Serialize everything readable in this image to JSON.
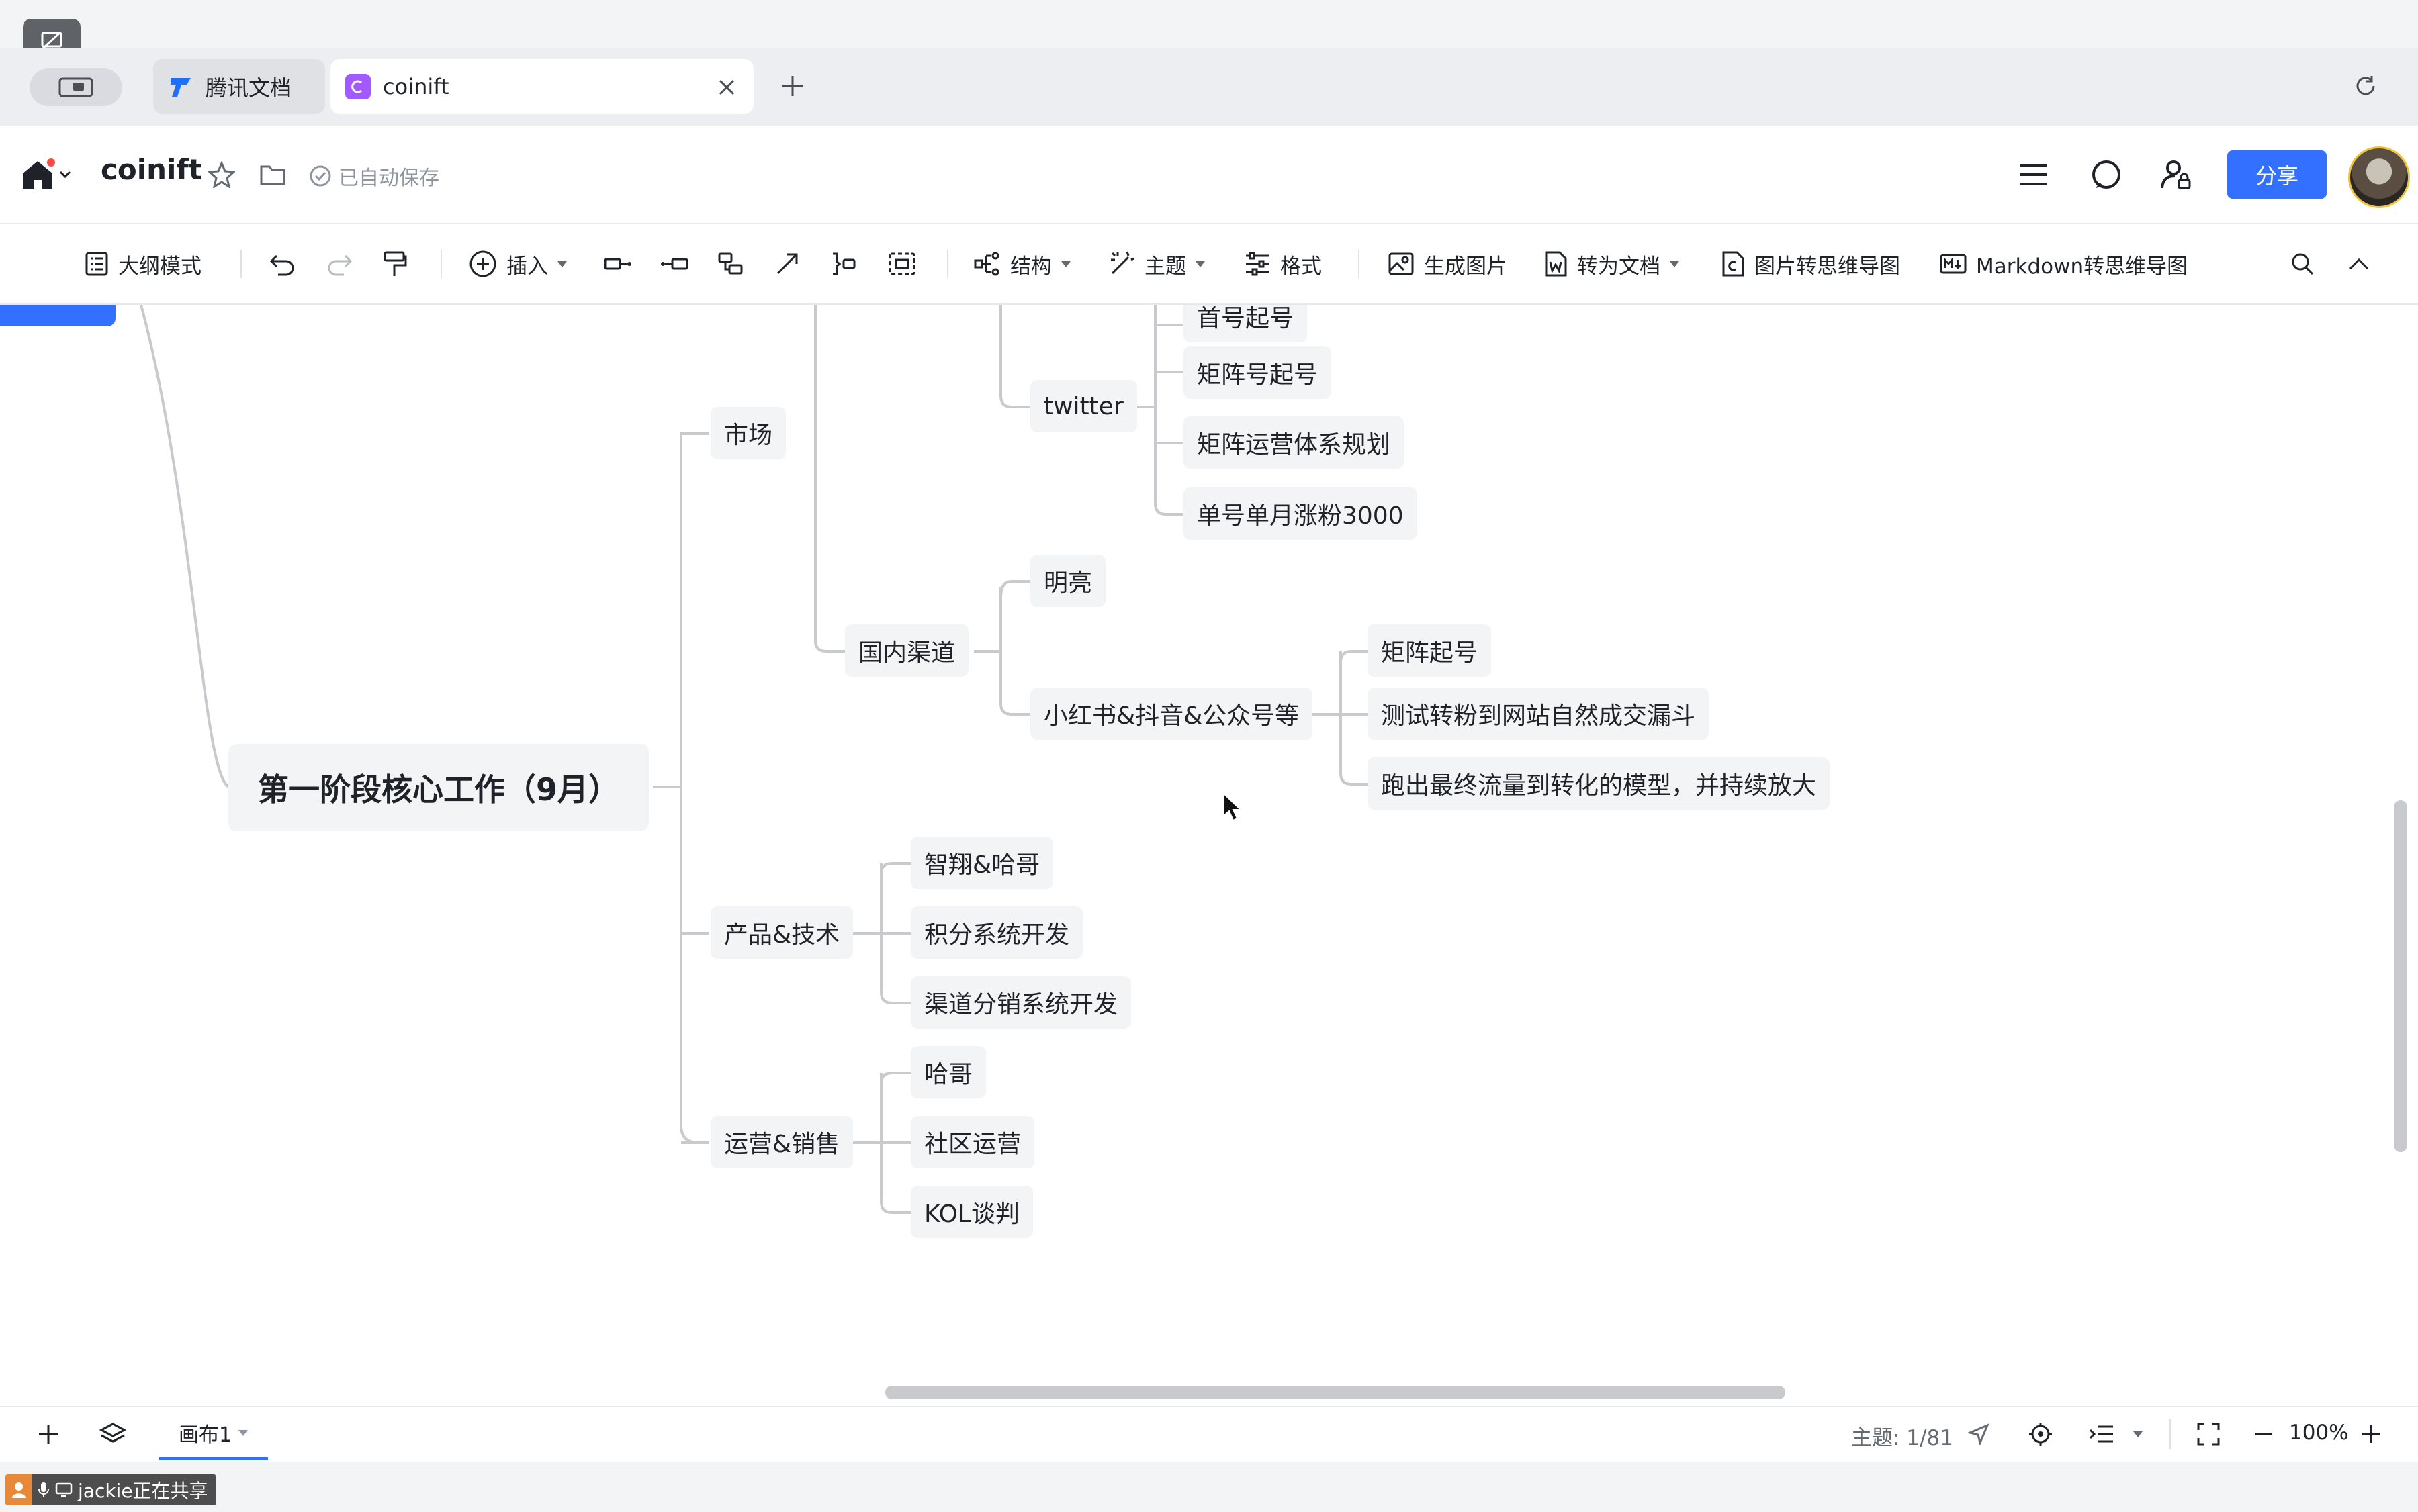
{
  "browser": {
    "tabs": [
      {
        "label": "腾讯文档",
        "active": false
      },
      {
        "label": "coinift",
        "active": true
      }
    ]
  },
  "header": {
    "title": "coinift",
    "autosave": "已自动保存",
    "share_label": "分享"
  },
  "toolbar": {
    "outline_mode": "大纲模式",
    "insert": "插入",
    "structure": "结构",
    "theme": "主题",
    "format": "格式",
    "generate_image": "生成图片",
    "to_doc": "转为文档",
    "image_to_mindmap": "图片转思维导图",
    "markdown_to_mindmap": "Markdown转思维导图"
  },
  "mindmap": {
    "root": "第一阶段核心工作（9月）",
    "market": "市场",
    "twitter": "twitter",
    "twitter_children": [
      "首号起号",
      "矩阵号起号",
      "矩阵运营体系规划",
      "单号单月涨粉3000"
    ],
    "domestic": "国内渠道",
    "domestic_children": [
      "明亮",
      "小红书&抖音&公众号等"
    ],
    "xhs_children": [
      "矩阵起号",
      "测试转粉到网站自然成交漏斗",
      "跑出最终流量到转化的模型，并持续放大"
    ],
    "product_tech": "产品&技术",
    "product_tech_children": [
      "智翔&哈哥",
      "积分系统开发",
      "渠道分销系统开发"
    ],
    "ops_sales": "运营&销售",
    "ops_sales_children": [
      "哈哥",
      "社区运营",
      "KOL谈判"
    ]
  },
  "bottom": {
    "canvas_tab": "画布1",
    "topic_count": "主题: 1/81",
    "zoom": "100%"
  },
  "sharing": {
    "label": "jackie正在共享"
  },
  "colors": {
    "accent": "#3370ff",
    "node_bg": "#f3f4f6",
    "line": "#c8cacd"
  }
}
